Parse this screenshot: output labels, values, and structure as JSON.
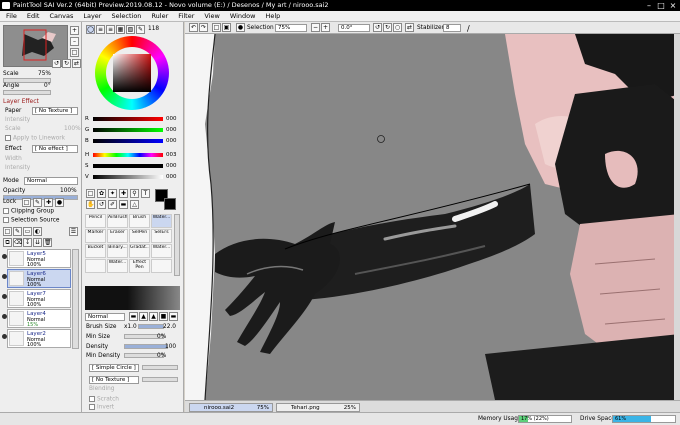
{
  "window": {
    "title": "PaintTool SAI Ver.2 (64bit) Preview.2019.08.12 - Novo volume (E:) / Desenos / My art / nirooo.sai2"
  },
  "menu": [
    "File",
    "Edit",
    "Canvas",
    "Layer",
    "Selection",
    "Ruler",
    "Filter",
    "View",
    "Window",
    "Help"
  ],
  "navigator": {
    "scale_label": "Scale",
    "scale_value": "75%",
    "angle_label": "Angle",
    "angle_value": "0°"
  },
  "layer_effect": {
    "heading": "Layer Effect",
    "paper_label": "Paper",
    "paper_value": "[ No Texture ]",
    "intensity_label": "Intensity",
    "scale_label": "Scale",
    "scale_value": "100%",
    "apply_linework": "Apply to Linework",
    "effect_label": "Effect",
    "effect_value": "[ No effect ]",
    "width_label": "Width",
    "intensity2_label": "Intensity"
  },
  "layer_props": {
    "mode_label": "Mode",
    "mode_value": "Normal",
    "opacity_label": "Opacity",
    "opacity_value": "100%",
    "lock_label": "Lock",
    "clipping": "Clipping Group",
    "selection_source": "Selection Source"
  },
  "layers": [
    {
      "name": "Layer5",
      "mode": "Normal",
      "opacity": "100%"
    },
    {
      "name": "Layer6",
      "mode": "Normal",
      "opacity": "100%"
    },
    {
      "name": "Layer7",
      "mode": "Normal",
      "opacity": "100%"
    },
    {
      "name": "Layer4",
      "mode": "Normal",
      "opacity": "15%"
    },
    {
      "name": "Layer2",
      "mode": "Normal",
      "opacity": "100%"
    }
  ],
  "color": {
    "r_label": "R",
    "g_label": "G",
    "b_label": "B",
    "h_label": "H",
    "s_label": "S",
    "v_label": "V",
    "r": "000",
    "g": "000",
    "b": "000",
    "h": "003",
    "s": "000",
    "v": "000",
    "wheel_small_value": "118"
  },
  "tools": [
    "Pencil",
    "AirBrush",
    "Brush",
    "Water...",
    "Marker",
    "Eraser",
    "SelPen",
    "SelErs",
    "Bucket",
    "Binary...",
    "Gradat...",
    "Water...",
    "",
    "Water...",
    "Effect Pen",
    ""
  ],
  "brush": {
    "mode_value": "Normal",
    "size_label": "Brush Size",
    "size_mult": "x1.0",
    "size_value": "22.0",
    "min_size_label": "Min Size",
    "min_size_value": "0%",
    "density_label": "Density",
    "density_value": "100",
    "min_density_label": "Min Density",
    "min_density_value": "0%",
    "shape_value": "[ Simple Circle ]",
    "texture_value": "[ No Texture ]",
    "blend_label": "Blending",
    "scratch_label": "Scratch",
    "invert_label": "Invert"
  },
  "toolbar": {
    "selection_label": "Selection",
    "zoom_value": "75%",
    "angle_value": "0.0°",
    "stabilizer_label": "Stabilizer",
    "stabilizer_value": "8"
  },
  "tabs": [
    {
      "name": "nirooo.sai2",
      "zoom": "75%"
    },
    {
      "name": "Tehari.png",
      "zoom": "25%"
    }
  ],
  "status": {
    "memory_label": "Memory Usage",
    "memory_value": "17% (22%)",
    "memory_fraction": 0.17,
    "drive_label": "Drive Space",
    "drive_value": "61%",
    "drive_fraction": 0.61
  }
}
